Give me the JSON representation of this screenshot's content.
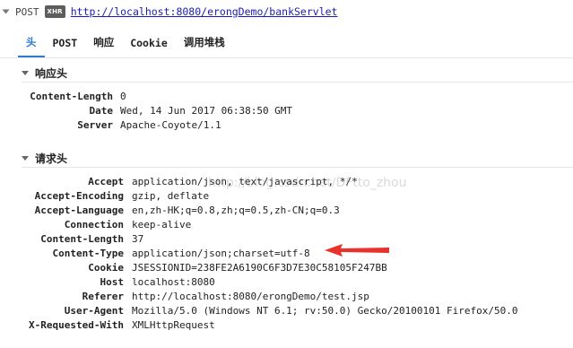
{
  "request": {
    "method": "POST",
    "badge": "XHR",
    "url": "http://localhost:8080/erongDemo/bankServlet"
  },
  "tabs": [
    {
      "label": "头",
      "active": true
    },
    {
      "label": "POST",
      "active": false
    },
    {
      "label": "响应",
      "active": false
    },
    {
      "label": "Cookie",
      "active": false
    },
    {
      "label": "调用堆栈",
      "active": false
    }
  ],
  "response_headers": {
    "title": "响应头",
    "rows": [
      {
        "name": "Content-Length",
        "value": "0"
      },
      {
        "name": "Date",
        "value": "Wed, 14 Jun 2017 06:38:50 GMT"
      },
      {
        "name": "Server",
        "value": "Apache-Coyote/1.1"
      }
    ]
  },
  "request_headers": {
    "title": "请求头",
    "rows": [
      {
        "name": "Accept",
        "value": "application/json, text/javascript, */*"
      },
      {
        "name": "Accept-Encoding",
        "value": "gzip, deflate"
      },
      {
        "name": "Accept-Language",
        "value": "en,zh-HK;q=0.8,zh;q=0.5,zh-CN;q=0.3"
      },
      {
        "name": "Connection",
        "value": "keep-alive"
      },
      {
        "name": "Content-Length",
        "value": "37"
      },
      {
        "name": "Content-Type",
        "value": "application/json;charset=utf-8"
      },
      {
        "name": "Cookie",
        "value": "JSESSIONID=238FE2A6190C6F3D7E30C58105F247BB"
      },
      {
        "name": "Host",
        "value": "localhost:8080"
      },
      {
        "name": "Referer",
        "value": "http://localhost:8080/erongDemo/test.jsp"
      },
      {
        "name": "User-Agent",
        "value": "Mozilla/5.0 (Windows NT 6.1; rv:50.0) Gecko/20100101 Firefox/50.0"
      },
      {
        "name": "X-Requested-With",
        "value": "XMLHttpRequest"
      }
    ]
  },
  "watermark": "http://blog.csdn.net/DFtto_zhou",
  "colors": {
    "active_tab": "#2d7cd1",
    "url_link": "#1c1cb5",
    "annotation_arrow": "#e8322b",
    "xhr_badge": "#5d5d5d"
  }
}
